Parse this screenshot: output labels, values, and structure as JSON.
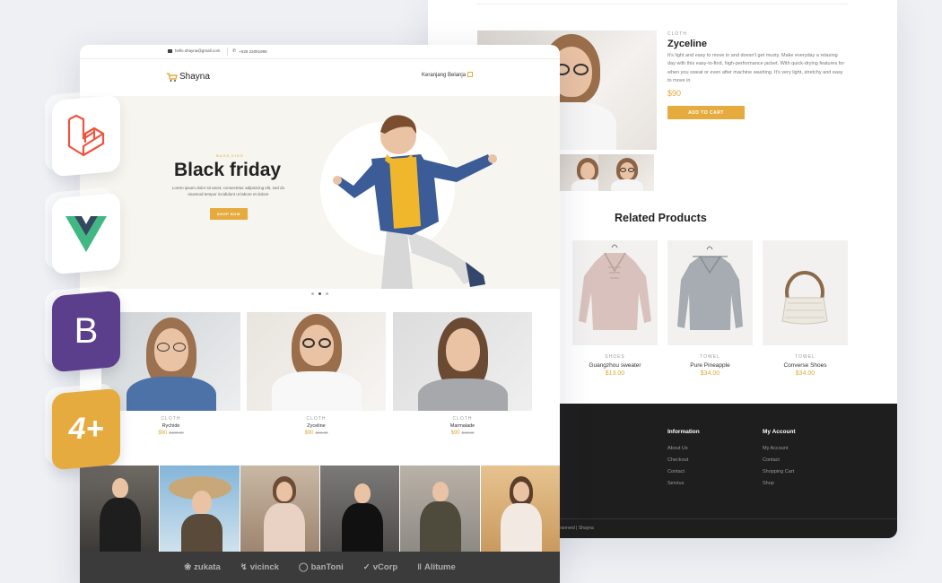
{
  "back": {
    "detail": {
      "category": "CLOTH",
      "title": "Zyceline",
      "description": "It's light and easy to move in and doesn't get musty. Make everyday a relaxing day with this easy-to-find, high-performance jacket. With quick-drying features for when you sweat or even after machine washing. It's very light, stretchy and easy to move in",
      "price": "$90",
      "button": "ADD TO CART"
    },
    "related_heading": "Related Products",
    "related": [
      {
        "category": "SHOES",
        "name": "Guangzhou sweater",
        "price": "$13.00"
      },
      {
        "category": "TOWEL",
        "name": "Pure Pineapple",
        "price": "$34.00"
      },
      {
        "category": "TOWEL",
        "name": "Converse Shoes",
        "price": "$34.00"
      }
    ],
    "footer": {
      "col1_title": "Information",
      "col1_links": [
        "About Us",
        "Checkout",
        "Contact",
        "Servius"
      ],
      "col2_title": "My Account",
      "col2_links": [
        "My Account",
        "Contact",
        "Shopping Cart",
        "Shop"
      ],
      "copyright": "eserved | Shayna"
    }
  },
  "front": {
    "topbar": {
      "email": "hello.shayna@gmail.com",
      "phone": "+628 22081996"
    },
    "logo": "Shayna",
    "cart_label": "Keranjang Belanja",
    "hero": {
      "subtitle": "BAGS,KIDS",
      "title": "Black friday",
      "description": "Lorem ipsum dolor sit amet, consectetur adipisicing elit, sed do eiusmod tempor incididunt ut labore et dolore",
      "button": "SHOP NOW"
    },
    "products": [
      {
        "category": "CLOTH",
        "name": "Rychide",
        "price": "$90",
        "old_price": "$100.00"
      },
      {
        "category": "CLOTH",
        "name": "Zyceline",
        "price": "$90",
        "old_price": "$40.00"
      },
      {
        "category": "CLOTH",
        "name": "Marmalade",
        "price": "$90",
        "old_price": "$40.00"
      }
    ],
    "brands": [
      "zukata",
      "vicinck",
      "banToni",
      "vCorp",
      "Alitume"
    ]
  },
  "badges": [
    "laravel-icon",
    "vue-icon",
    "bootstrap-icon",
    "four-plus-icon"
  ],
  "colors": {
    "accent": "#e5ab3e",
    "footer": "#1e1e1e",
    "bootstrap": "#5b3f8c",
    "laravel": "#f05340",
    "vue_green": "#41b883",
    "vue_dark": "#35495e"
  }
}
